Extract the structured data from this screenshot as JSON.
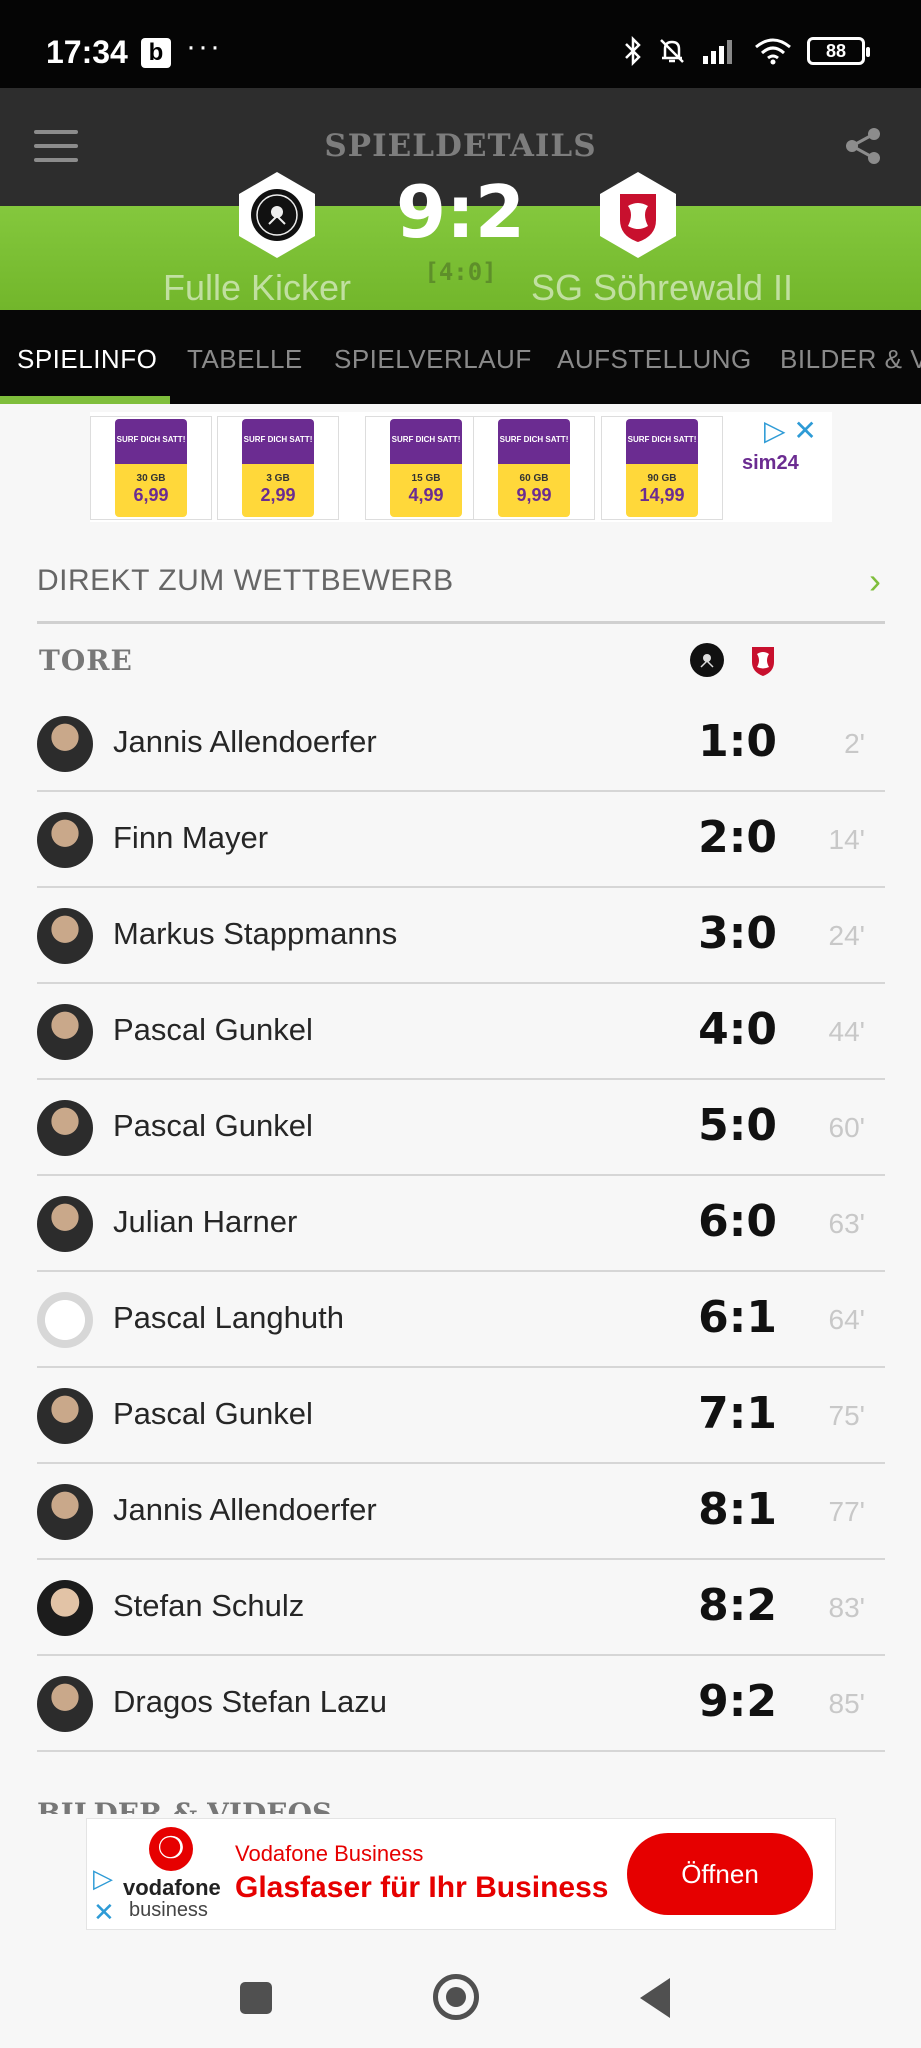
{
  "status_bar": {
    "time": "17:34",
    "app_badge": "b",
    "more": "···",
    "battery": "88"
  },
  "header": {
    "title": "SPIELDETAILS",
    "score": "9:2",
    "halftime": "[4:0]",
    "home_team": "Fulle Kicker Kassel",
    "away_team": "SG Söhrewald II",
    "home_color": "#2d2d2d",
    "accent": "#7fbe3c"
  },
  "tabs": [
    {
      "label": "SPIELINFO"
    },
    {
      "label": "TABELLE"
    },
    {
      "label": "SPIELVERLAUF"
    },
    {
      "label": "AUFSTELLUNG"
    },
    {
      "label": "BILDER & V"
    }
  ],
  "ad_top": {
    "cards": [
      {
        "gb": "30 GB",
        "price": "6,99"
      },
      {
        "gb": "3 GB",
        "price": "2,99"
      },
      {
        "gb": "15 GB",
        "price": "4,99"
      },
      {
        "gb": "60 GB",
        "price": "9,99"
      },
      {
        "gb": "90 GB",
        "price": "14,99"
      }
    ],
    "surf_text": "SURF DICH SATT!",
    "brand": "sim24",
    "close": "✕",
    "adchoices": "▷"
  },
  "competition_link": {
    "label": "DIREKT ZUM WETTBEWERB",
    "arrow": "›"
  },
  "goals_section": {
    "title": "TORE",
    "goals": [
      {
        "player": "Jannis Allendoerfer",
        "score": "1:0",
        "minute": "2'"
      },
      {
        "player": "Finn Mayer",
        "score": "2:0",
        "minute": "14'"
      },
      {
        "player": "Markus Stappmanns",
        "score": "3:0",
        "minute": "24'"
      },
      {
        "player": "Pascal Gunkel",
        "score": "4:0",
        "minute": "44'"
      },
      {
        "player": "Pascal Gunkel",
        "score": "5:0",
        "minute": "60'"
      },
      {
        "player": "Julian Harner",
        "score": "6:0",
        "minute": "63'"
      },
      {
        "player": "Pascal Langhuth",
        "score": "6:1",
        "minute": "64'"
      },
      {
        "player": "Pascal Gunkel",
        "score": "7:1",
        "minute": "75'"
      },
      {
        "player": "Jannis Allendoerfer",
        "score": "8:1",
        "minute": "77'"
      },
      {
        "player": "Stefan Schulz",
        "score": "8:2",
        "minute": "83'"
      },
      {
        "player": "Dragos Stefan Lazu",
        "score": "9:2",
        "minute": "85'"
      }
    ]
  },
  "next_section_title": "BILDER & VIDEOS",
  "ad_bottom": {
    "brand_name": "vodafone",
    "brand_sub": "business",
    "headline": "Vodafone Business",
    "title": "Glasfaser für Ihr Business",
    "cta": "Öffnen",
    "brand_color": "#e60000"
  }
}
